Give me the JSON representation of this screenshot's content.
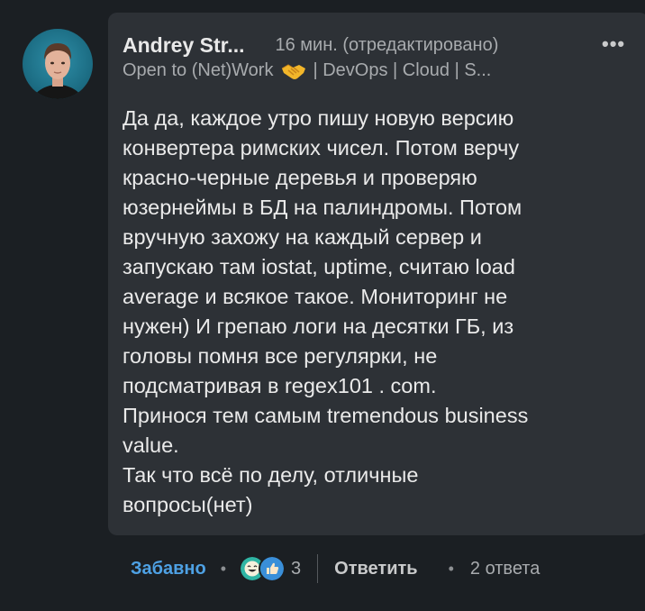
{
  "comment": {
    "author_name": "Andrey Str...",
    "timestamp": "16 мин. (отредактировано)",
    "more_icon": "•••",
    "headline_part1": "Open to (Net)Work",
    "headline_icon": "handshake-icon",
    "headline_part2": "| DevOps | Cloud | S...",
    "message_lines": [
      "Да да, каждое утро пишу новую версию",
      "конвертера римских чисел. Потом верчу",
      "красно-черные деревья и проверяю",
      "юзернеймы в БД на палиндромы. Потом",
      "вручную захожу на каждый сервер и",
      "запускаю там iostat, uptime, считаю load",
      "average и всякое такое. Мониторинг не",
      "нужен) И грепаю логи на десятки ГБ, из",
      "головы помня все регулярки, не",
      "подсматривая в regex101 . com.",
      "Принося тем самым tremendous business",
      "value.",
      "Так что всё по делу, отличные",
      "вопросы(нет)"
    ]
  },
  "actions": {
    "reaction_label": "Забавно",
    "separator": "•",
    "reaction_count": "3",
    "reply_label": "Ответить",
    "replies_label": "2 ответа"
  },
  "colors": {
    "page_background": "#1b1f23",
    "bubble_background": "#2d3136",
    "accent_link": "#4ea1e4",
    "text_primary": "#eaeaea",
    "text_secondary": "#a8abae"
  }
}
